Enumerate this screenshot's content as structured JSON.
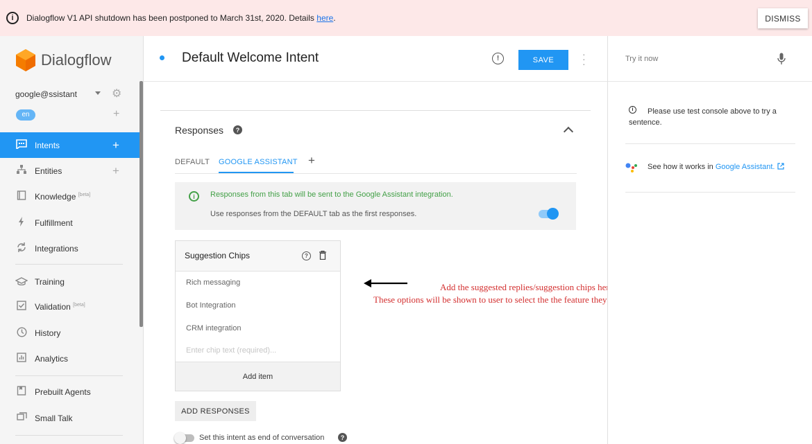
{
  "banner": {
    "message": "Dialogflow V1 API shutdown has been postponed to March 31st, 2020. Details ",
    "link_text": "here",
    "period": ".",
    "dismiss_label": "DISMISS"
  },
  "sidebar": {
    "brand": "Dialogflow",
    "agent_name": "google@ssistant",
    "language": "en",
    "items": [
      {
        "label": "Intents",
        "icon": "chat-icon"
      },
      {
        "label": "Entities",
        "icon": "hierarchy-icon"
      },
      {
        "label": "Knowledge",
        "sup": "[beta]",
        "icon": "book-icon"
      },
      {
        "label": "Fulfillment",
        "icon": "bolt-icon"
      },
      {
        "label": "Integrations",
        "icon": "refresh-icon"
      },
      {
        "label": "Training",
        "icon": "graduation-cap-icon"
      },
      {
        "label": "Validation",
        "sup": "[beta]",
        "icon": "checkbox-icon"
      },
      {
        "label": "History",
        "icon": "clock-icon"
      },
      {
        "label": "Analytics",
        "icon": "bar-chart-icon"
      },
      {
        "label": "Prebuilt Agents",
        "icon": "agent-icon"
      },
      {
        "label": "Small Talk",
        "icon": "chat-bubble-icon"
      }
    ]
  },
  "header": {
    "title": "Default Welcome Intent",
    "save_label": "SAVE"
  },
  "responses": {
    "title": "Responses",
    "tabs": [
      "DEFAULT",
      "GOOGLE ASSISTANT"
    ],
    "active_tab": "GOOGLE ASSISTANT",
    "info_green": "Responses from this tab will be sent to the Google Assistant integration.",
    "info_gray": "Use responses from the DEFAULT tab as the first responses.",
    "use_default_toggle": true,
    "chips_card": {
      "title": "Suggestion Chips",
      "chips": [
        "Rich messaging",
        "Bot Integration",
        "CRM integration"
      ],
      "placeholder": "Enter chip text (required)...",
      "add_item_label": "Add item"
    },
    "add_responses_label": "ADD RESPONSES",
    "end_conversation_label": "Set this intent as end of conversation",
    "end_conversation_toggle": false
  },
  "annotation": {
    "line1": "Add the suggested replies/suggestion chips here.",
    "line2": "These options will be shown to user to select the the feature they are interested in"
  },
  "right_panel": {
    "try_placeholder": "Try it now",
    "info_text": "Please use test console above to try a sentence.",
    "assistant_prefix": "See how it works in ",
    "assistant_link": "Google Assistant."
  },
  "colors": {
    "primary": "#2196f3",
    "banner_bg": "#fde8e8",
    "success": "#43a047",
    "annotation": "#d32f2f"
  }
}
